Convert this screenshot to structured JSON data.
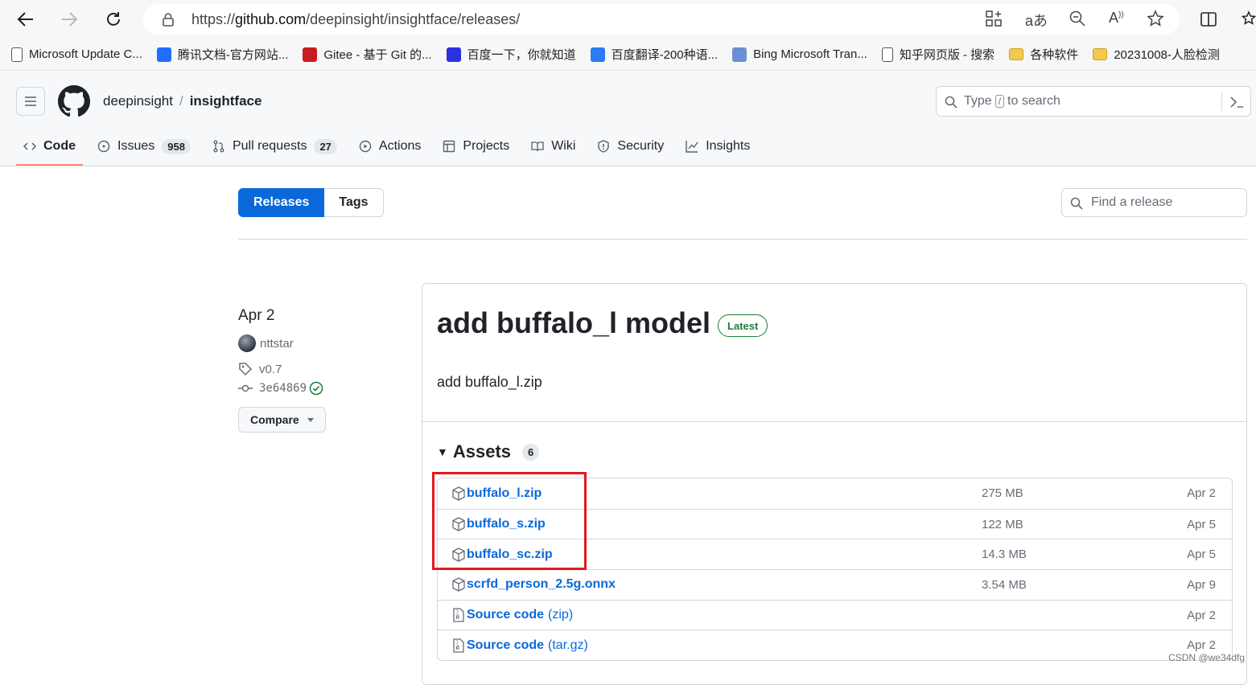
{
  "browser": {
    "url_prefix": "https://",
    "url_host": "github.com",
    "url_path": "/deepinsight/insightface/releases/",
    "bookmarks": [
      {
        "label": "Microsoft Update C...",
        "icon": "page-icon",
        "color": "#555555"
      },
      {
        "label": "腾讯文档-官方网站...",
        "icon": "tencent-docs-icon",
        "color": "#1e6fff"
      },
      {
        "label": "Gitee - 基于 Git 的...",
        "icon": "gitee-icon",
        "color": "#c71d23"
      },
      {
        "label": "百度一下，你就知道",
        "icon": "baidu-icon",
        "color": "#2932e1"
      },
      {
        "label": "百度翻译-200种语...",
        "icon": "translate-icon",
        "color": "#2b7bf5"
      },
      {
        "label": "Bing Microsoft Tran...",
        "icon": "bing-translator-icon",
        "color": "#6b8fd6"
      },
      {
        "label": "知乎网页版 - 搜索",
        "icon": "page-icon",
        "color": "#555555"
      },
      {
        "label": "各种软件",
        "icon": "folder-icon",
        "color": "#f2c94c"
      },
      {
        "label": "20231008-人脸检测",
        "icon": "folder-icon",
        "color": "#f2c94c"
      }
    ]
  },
  "github": {
    "owner": "deepinsight",
    "repo": "insightface",
    "search": {
      "prefix": "Type",
      "key": "/",
      "suffix": "to search"
    },
    "tabs": [
      {
        "label": "Code",
        "count": ""
      },
      {
        "label": "Issues",
        "count": "958"
      },
      {
        "label": "Pull requests",
        "count": "27"
      },
      {
        "label": "Actions",
        "count": ""
      },
      {
        "label": "Projects",
        "count": ""
      },
      {
        "label": "Wiki",
        "count": ""
      },
      {
        "label": "Security",
        "count": ""
      },
      {
        "label": "Insights",
        "count": ""
      }
    ]
  },
  "releases": {
    "subnav": {
      "releases": "Releases",
      "tags": "Tags"
    },
    "find_placeholder": "Find a release",
    "release": {
      "date": "Apr 2",
      "author": "nttstar",
      "tag": "v0.7",
      "commit": "3e64869",
      "compare": "Compare",
      "title": "add buffalo_l model",
      "badge": "Latest",
      "body": "add buffalo_l.zip",
      "assets_label": "Assets",
      "assets_count": "6",
      "assets": [
        {
          "name": "buffalo_l.zip",
          "ext": "",
          "size": "275 MB",
          "date": "Apr 2",
          "icon": "package-icon"
        },
        {
          "name": "buffalo_s.zip",
          "ext": "",
          "size": "122 MB",
          "date": "Apr 5",
          "icon": "package-icon"
        },
        {
          "name": "buffalo_sc.zip",
          "ext": "",
          "size": "14.3 MB",
          "date": "Apr 5",
          "icon": "package-icon"
        },
        {
          "name": "scrfd_person_2.5g.onnx",
          "ext": "",
          "size": "3.54 MB",
          "date": "Apr 9",
          "icon": "package-icon"
        },
        {
          "name": "Source code",
          "ext": "(zip)",
          "size": "",
          "date": "Apr 2",
          "icon": "file-zip-icon"
        },
        {
          "name": "Source code",
          "ext": "(tar.gz)",
          "size": "",
          "date": "Apr 2",
          "icon": "file-zip-icon"
        }
      ]
    }
  },
  "watermark": "CSDN @we34dfg",
  "colors": {
    "accent": "#0969da",
    "highlight": "#e1191f",
    "latest": "#1a7f37"
  }
}
